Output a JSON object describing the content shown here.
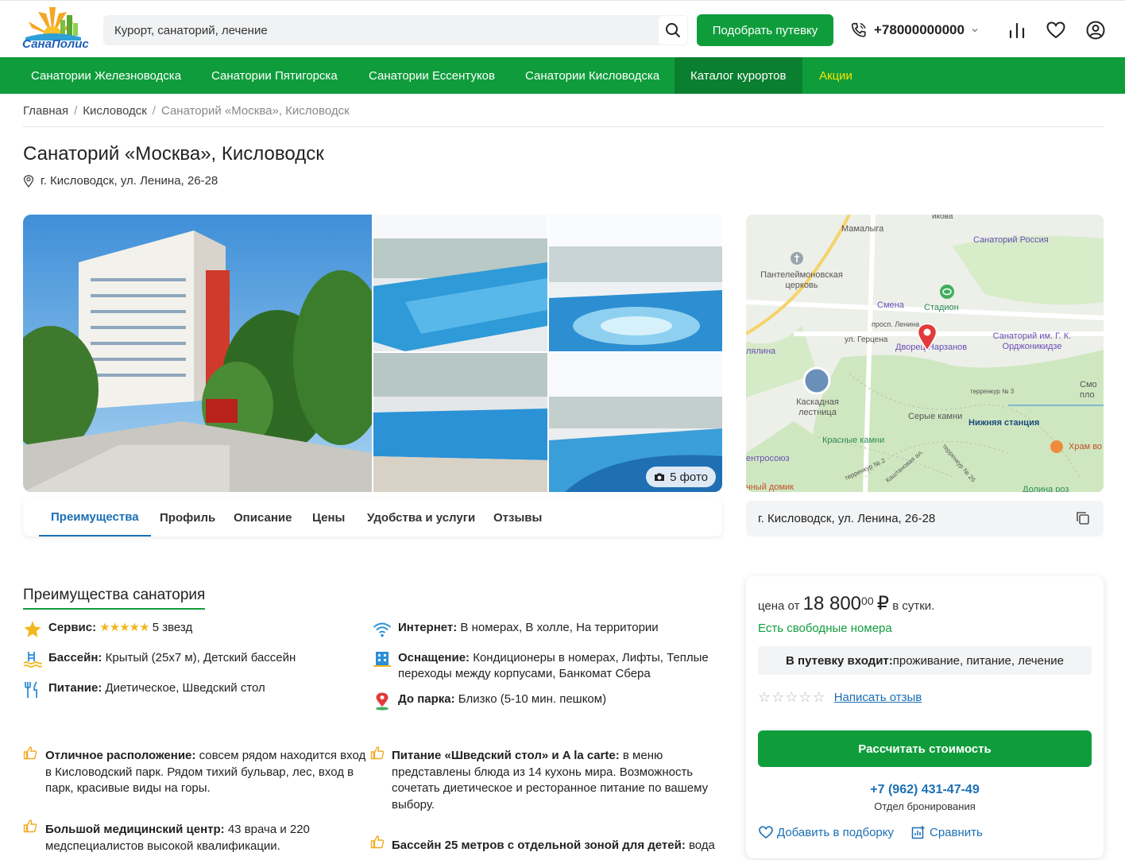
{
  "header": {
    "logo_text": "СанаПолис",
    "search_placeholder": "Курорт, санаторий, лечение",
    "pick_button": "Подобрать путевку",
    "phone": "+78000000000"
  },
  "nav": {
    "items": [
      {
        "label": "Санатории Железноводска"
      },
      {
        "label": "Санатории Пятигорска"
      },
      {
        "label": "Санатории Ессентуков"
      },
      {
        "label": "Санатории Кисловодска"
      },
      {
        "label": "Каталог курортов"
      },
      {
        "label": "Акции"
      }
    ]
  },
  "breadcrumb": [
    "Главная",
    "Кисловодск",
    "Санаторий «Москва», Кисловодск"
  ],
  "page": {
    "title": "Санаторий «Москва», Кисловодск",
    "address": "г. Кисловодск, ул. Ленина, 26-28"
  },
  "gallery": {
    "photo_count": "5 фото"
  },
  "map": {
    "labels": [
      "Мамалыга",
      "Санаторий Россия",
      "Пантелеймоновская церковь",
      "Смена",
      "Стадион",
      "просп. Ленина",
      "ул. Герцена",
      "Дворец Нарзанов",
      "Санаторий им. Г. К. Орджоникидзе",
      "Каскадная лестница",
      "Серые камни",
      "Нижняя станция",
      "Красные камни",
      "Храм во",
      "терренкур № 3",
      "терренкур № 2",
      "Каштановая ал.",
      "терренкур № 2б",
      "лялина",
      "Смо пло",
      "ентросоюз",
      "чный домик",
      "Долина роз",
      "икова"
    ]
  },
  "map_address": "г. Кисловодск, ул. Ленина, 26-28",
  "tabs": [
    "Преимущества",
    "Профиль",
    "Описание",
    "Цены",
    "Удобства и услуги",
    "Отзывы"
  ],
  "advantages": {
    "title": "Преимущества санатория",
    "features": [
      {
        "label": "Сервис:",
        "value": "5 звезд",
        "stars": "★★★★★"
      },
      {
        "label": "Бассейн:",
        "value": "Крытый (25x7 м), Детский бассейн"
      },
      {
        "label": "Питание:",
        "value": "Диетическое, Шведский стол"
      },
      {
        "label": "Интернет:",
        "value": "В номерах, В холле, На территории"
      },
      {
        "label": "Оснащение:",
        "value": "Кондиционеры в номерах, Лифты, Теплые переходы между корпусами, Банкомат Сбера"
      },
      {
        "label": "До парка:",
        "value": "Близко (5-10 мин. пешком)"
      }
    ],
    "bullets": [
      {
        "bold": "Отличное расположение:",
        "text": " совсем рядом находится вход в Кисловодский парк. Рядом тихий бульвар, лес, вход в парк, красивые виды на горы."
      },
      {
        "bold": "Питание «Шведский стол» и A la carte:",
        "text": " в меню представлены блюда из 14 кухонь мира. Возможность сочетать диетическое и ресторанное питание по вашему выбору."
      },
      {
        "bold": "Большой медицинский центр:",
        "text": " 43 врача и 220 медспециалистов высокой квалификации."
      },
      {
        "bold": "Бассейн 25 метров с отдельной зоной для детей:",
        "text": " вода"
      }
    ]
  },
  "booking": {
    "price_prefix": "цена от",
    "price_main": "18 800",
    "price_cents": "00",
    "currency": "₽",
    "price_suffix": "в сутки.",
    "availability": "Есть свободные номера",
    "includes_label": "В путевку входит:",
    "includes_value": " проживание, питание, лечение",
    "empty_stars": "☆☆☆☆☆",
    "write_review": "Написать отзыв",
    "calc_button": "Рассчитать стоимость",
    "phone": "+7 (962) 431-47-49",
    "department": "Отдел бронирования",
    "add_to_list": "Добавить в подборку",
    "compare": "Сравнить"
  },
  "colors": {
    "brand_green": "#0f9d3c",
    "link_blue": "#1b6fb5",
    "star_yellow": "#f2b81f",
    "promo_yellow": "#f5e500"
  }
}
